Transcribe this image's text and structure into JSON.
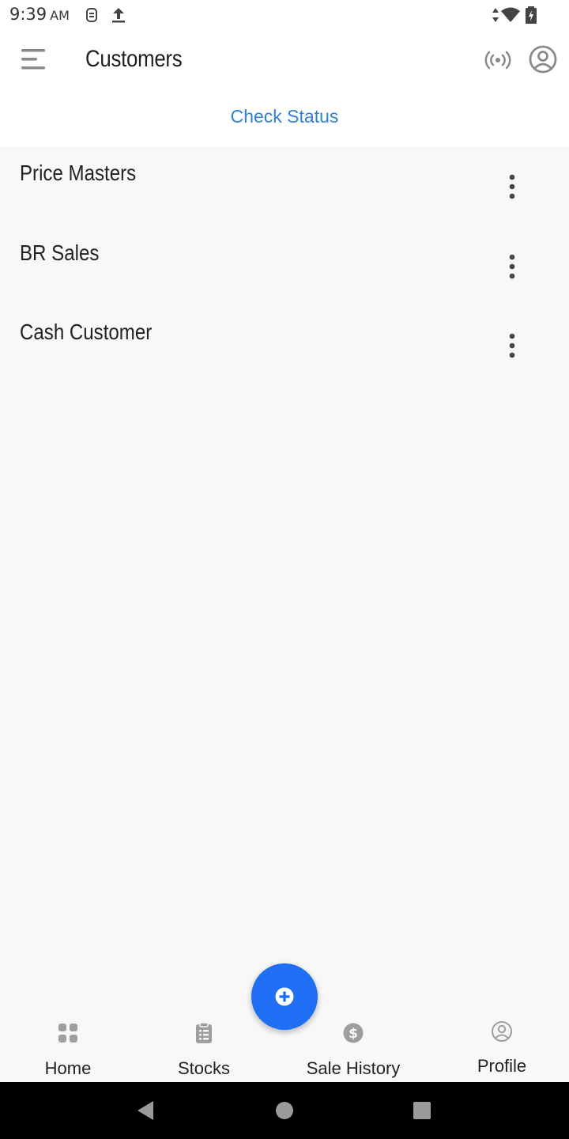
{
  "status_bar": {
    "time": "9:39",
    "ampm": "AM"
  },
  "app_bar": {
    "title": "Customers",
    "check_status_label": "Check Status"
  },
  "customers": [
    {
      "name": "Price Masters"
    },
    {
      "name": "BR Sales"
    },
    {
      "name": "Cash Customer"
    }
  ],
  "bottom_nav": {
    "home_label": "Home",
    "stocks_label": "Stocks",
    "sale_history_label": "Sale History",
    "profile_label": "Profile"
  },
  "colors": {
    "accent": "#2f7fe0",
    "fab": "#1e6ff5",
    "icon_gray": "#9e9e9e",
    "background": "#f8f8f8"
  },
  "icons": [
    "menu-icon",
    "broadcast-icon",
    "account-circle-icon",
    "more-vert-icon",
    "add-circle-icon",
    "home-grid-icon",
    "clipboard-icon",
    "dollar-icon",
    "profile-icon"
  ]
}
